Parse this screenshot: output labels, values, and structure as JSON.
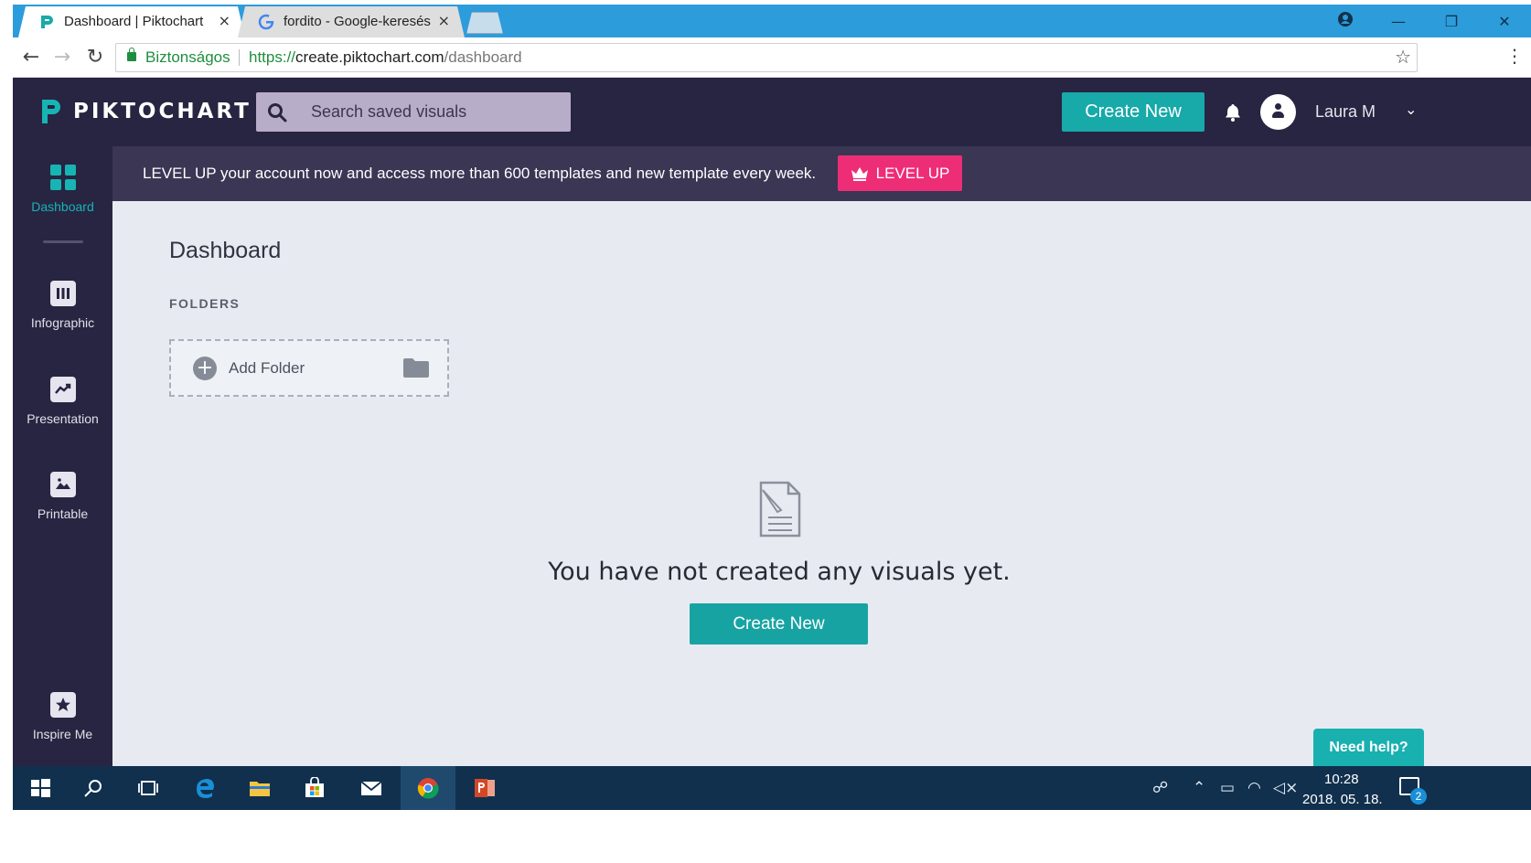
{
  "browser": {
    "tabs": [
      {
        "title": "Dashboard | Piktochart",
        "close": "×"
      },
      {
        "title": "fordito - Google-keresés",
        "close": "×"
      }
    ],
    "secure_label": "Biztonságos",
    "url_scheme": "https://",
    "url_host": "create.piktochart.com",
    "url_path": "/dashboard"
  },
  "header": {
    "logo_text": "PIKTOCHART",
    "search_placeholder": "Search saved visuals",
    "create_new_label": "Create New",
    "user_name": "Laura M"
  },
  "sidebar": {
    "items": [
      {
        "label": "Dashboard"
      },
      {
        "label": "Infographic"
      },
      {
        "label": "Presentation"
      },
      {
        "label": "Printable"
      },
      {
        "label": "Inspire Me"
      }
    ]
  },
  "promo": {
    "text": "LEVEL UP your account now and access more than 600 templates and new template every week.",
    "button_label": "LEVEL UP"
  },
  "main": {
    "title": "Dashboard",
    "folders_heading": "FOLDERS",
    "add_folder_label": "Add Folder",
    "empty_message": "You have not created any visuals yet.",
    "create_new_label": "Create New",
    "need_help_label": "Need help?"
  },
  "taskbar": {
    "time": "10:28",
    "date": "2018. 05. 18.",
    "notification_count": "2"
  },
  "colors": {
    "header_bg": "#272541",
    "accent_teal": "#18a9a9",
    "level_up_pink": "#ee2d77",
    "main_bg": "#e7ebf1"
  }
}
